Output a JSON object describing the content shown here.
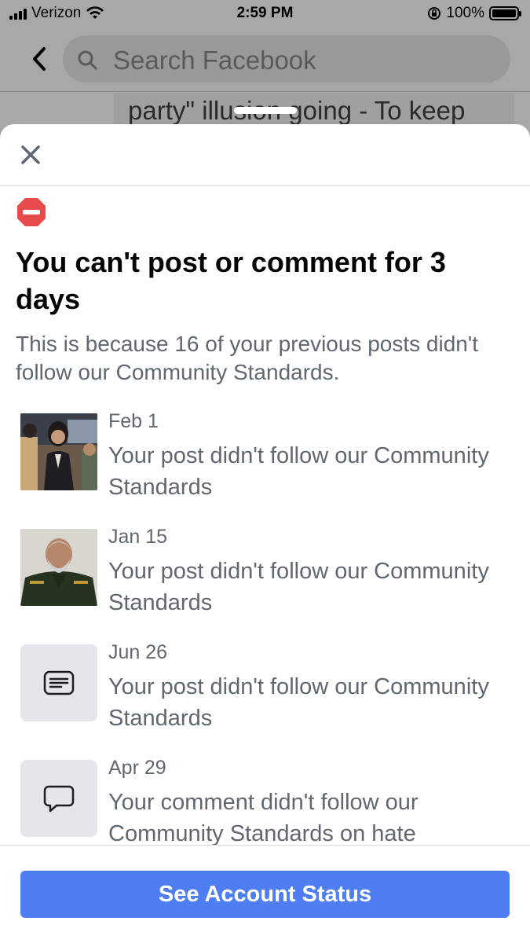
{
  "status_bar": {
    "carrier": "Verizon",
    "time": "2:59 PM",
    "battery": "100%"
  },
  "search": {
    "placeholder": "Search Facebook"
  },
  "background_post": {
    "text": "party\" illusion going - To keep"
  },
  "sheet": {
    "title": "You can't post or comment for 3 days",
    "subtitle": "This is because 16 of your previous posts didn't follow our Community Standards.",
    "items": [
      {
        "date": "Feb 1",
        "description": "Your post didn't follow our Community Standards",
        "thumb": "photo-group"
      },
      {
        "date": "Jan 15",
        "description": "Your post didn't follow our Community Standards",
        "thumb": "photo-portrait"
      },
      {
        "date": "Jun 26",
        "description": "Your post didn't follow our Community Standards",
        "thumb": "post-icon"
      },
      {
        "date": "Apr 29",
        "description": "Your comment didn't follow our Community Standards on hate",
        "thumb": "comment-icon"
      }
    ],
    "button_label": "See Account Status"
  },
  "colors": {
    "accent": "#4f7ef3",
    "stop_red": "#e74c4c",
    "secondary_text": "#606770"
  }
}
